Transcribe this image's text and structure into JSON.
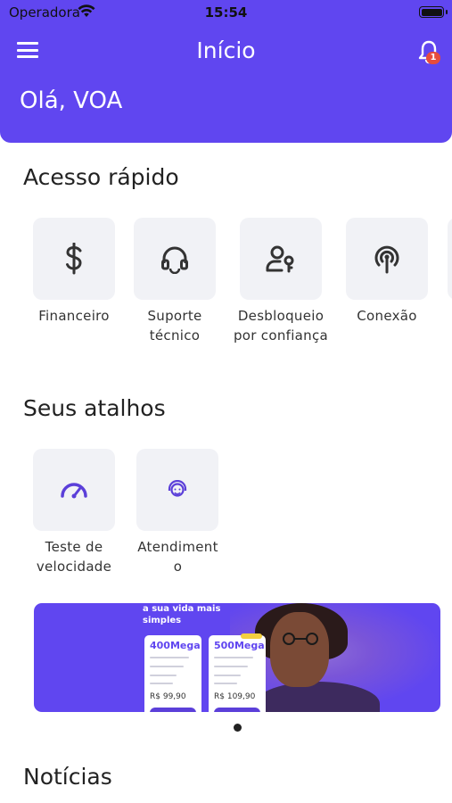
{
  "status_bar": {
    "carrier": "Operadora",
    "time": "15:54"
  },
  "header": {
    "title": "Início",
    "greeting": "Olá, VOA",
    "notification_count": "1"
  },
  "quick_access": {
    "title": "Acesso rápido",
    "items": [
      {
        "line1": "Financeiro",
        "line2": "",
        "icon": "dollar-icon"
      },
      {
        "line1": "Suporte",
        "line2": "técnico",
        "icon": "headset-icon"
      },
      {
        "line1": "Desbloqueio",
        "line2": "por confiança",
        "icon": "user-key-icon"
      },
      {
        "line1": "Conexão",
        "line2": "",
        "icon": "antenna-icon"
      }
    ]
  },
  "shortcuts": {
    "title": "Seus atalhos",
    "items": [
      {
        "line1": "Teste de",
        "line2": "velocidade",
        "icon": "speedometer-icon"
      },
      {
        "line1": "Atendiment",
        "line2": "o",
        "icon": "support-agent-icon"
      }
    ]
  },
  "banner": {
    "headline_1": "a sua vida mais",
    "headline_2": "simples",
    "plans": [
      {
        "name": "400Mega",
        "price": "R$ 99,90"
      },
      {
        "name": "500Mega",
        "price": "R$ 109,90"
      }
    ]
  },
  "news": {
    "title": "Notícias"
  },
  "colors": {
    "primary": "#6046f0",
    "tile_bg": "#f1f2f6",
    "shortcut_icon": "#5b3fd9",
    "badge": "#e74c3c"
  }
}
